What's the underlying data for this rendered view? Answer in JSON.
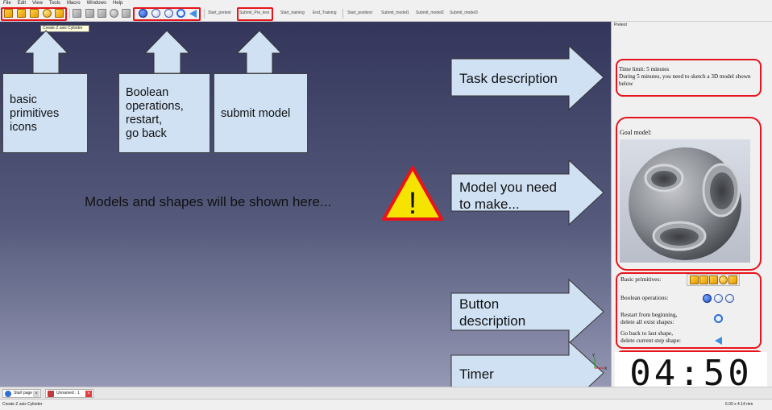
{
  "menu": [
    "File",
    "Edit",
    "View",
    "Tools",
    "Macro",
    "Windows",
    "Help"
  ],
  "toolbar": {
    "primitive_icons": [
      "box-icon",
      "cylinder-icon",
      "cone-icon",
      "sphere-icon",
      "torus-icon"
    ],
    "inactive_icons": [
      "box-grey-icon",
      "cylinder-grey-icon",
      "cone-grey-icon",
      "sphere-grey-icon",
      "torus-grey-icon"
    ],
    "boolean_icons": [
      "union-icon",
      "cut-icon",
      "intersection-icon",
      "restart-icon",
      "back-arrow-icon"
    ],
    "links": [
      "Start_pretest",
      "Submit_Pre_test",
      "Start_training",
      "End_Training",
      "Start_posttest",
      "Submit_model1",
      "Submit_model2",
      "Submit_model3"
    ],
    "tooltip": "Create Z axis Cylinder"
  },
  "annotations": {
    "primitives": [
      "basic",
      "primitives",
      "icons"
    ],
    "boolean": [
      "Boolean",
      "operations,",
      "restart,",
      "go back"
    ],
    "submit": "submit model",
    "task": "Task description",
    "model": [
      "Model you need",
      "to make..."
    ],
    "buttons": [
      "Button",
      "description"
    ],
    "timer": "Timer"
  },
  "view": {
    "message": "Models and shapes will be shown here...",
    "warning_symbol": "!",
    "axis_y": "Y",
    "axis_x": "X"
  },
  "panel": {
    "title": "Pretest",
    "time_limit": "Time limit: 5 minutes",
    "instructions": "During 5 minutes, you need to sketch a 3D model shown below",
    "goal_label": "Goal model:",
    "basic_label": "Basic primitives:",
    "boolean_label": "Boolean operations:",
    "restart_label": [
      "Restart from beginning,",
      "delete all exist shapes:"
    ],
    "back_label": [
      "Go back to last shape,",
      "delete current step shape:"
    ],
    "timer": "04:50"
  },
  "tabs": [
    "Start page",
    "Unnamed : 1"
  ],
  "status": {
    "left": "Create Z axis Cylinder",
    "right": "6.00 x 4.14 mm"
  },
  "colors": {
    "highlight": "#e8141b",
    "callout": "#d0e1f4",
    "primitive": "#f0a800",
    "boolean": "#2b5fd0"
  }
}
